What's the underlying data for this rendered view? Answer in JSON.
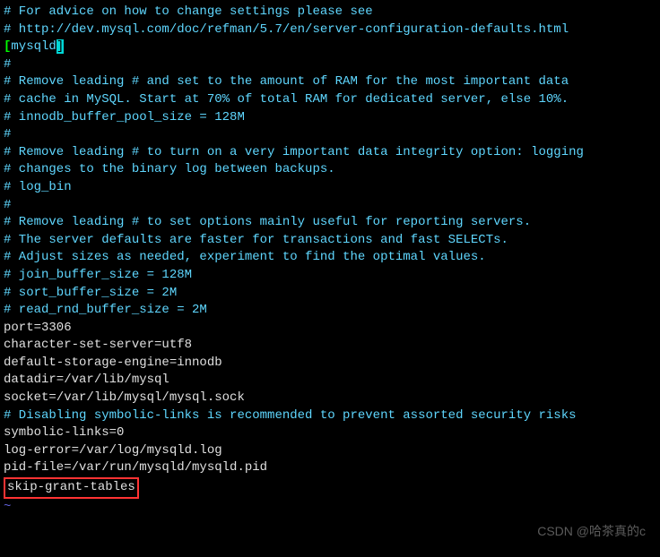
{
  "lines": {
    "c1": "# For advice on how to change settings please see",
    "c2": "# http://dev.mysql.com/doc/refman/5.7/en/server-configuration-defaults.html",
    "blank1": "",
    "section_open": "[",
    "section_name": "mysqld",
    "section_close": "]",
    "c3": "#",
    "c4": "# Remove leading # and set to the amount of RAM for the most important data",
    "c5": "# cache in MySQL. Start at 70% of total RAM for dedicated server, else 10%.",
    "c6": "# innodb_buffer_pool_size = 128M",
    "c7": "#",
    "c8": "# Remove leading # to turn on a very important data integrity option: logging",
    "c9": "# changes to the binary log between backups.",
    "c10": "# log_bin",
    "c11": "#",
    "c12": "# Remove leading # to set options mainly useful for reporting servers.",
    "c13": "# The server defaults are faster for transactions and fast SELECTs.",
    "c14": "# Adjust sizes as needed, experiment to find the optimal values.",
    "c15": "# join_buffer_size = 128M",
    "c16": "# sort_buffer_size = 2M",
    "c17": "# read_rnd_buffer_size = 2M",
    "p1": "port=3306",
    "p2": "character-set-server=utf8",
    "p3": "default-storage-engine=innodb",
    "blank2": "",
    "p4": "datadir=/var/lib/mysql",
    "p5": "socket=/var/lib/mysql/mysql.sock",
    "blank3": "",
    "c18": "# Disabling symbolic-links is recommended to prevent assorted security risks",
    "p6": "symbolic-links=0",
    "blank4": "",
    "p7": "log-error=/var/log/mysqld.log",
    "p8": "pid-file=/var/run/mysqld/mysqld.pid",
    "p9": "skip-grant-tables",
    "tilde": "~"
  },
  "watermark": "CSDN @哈茶真的c"
}
